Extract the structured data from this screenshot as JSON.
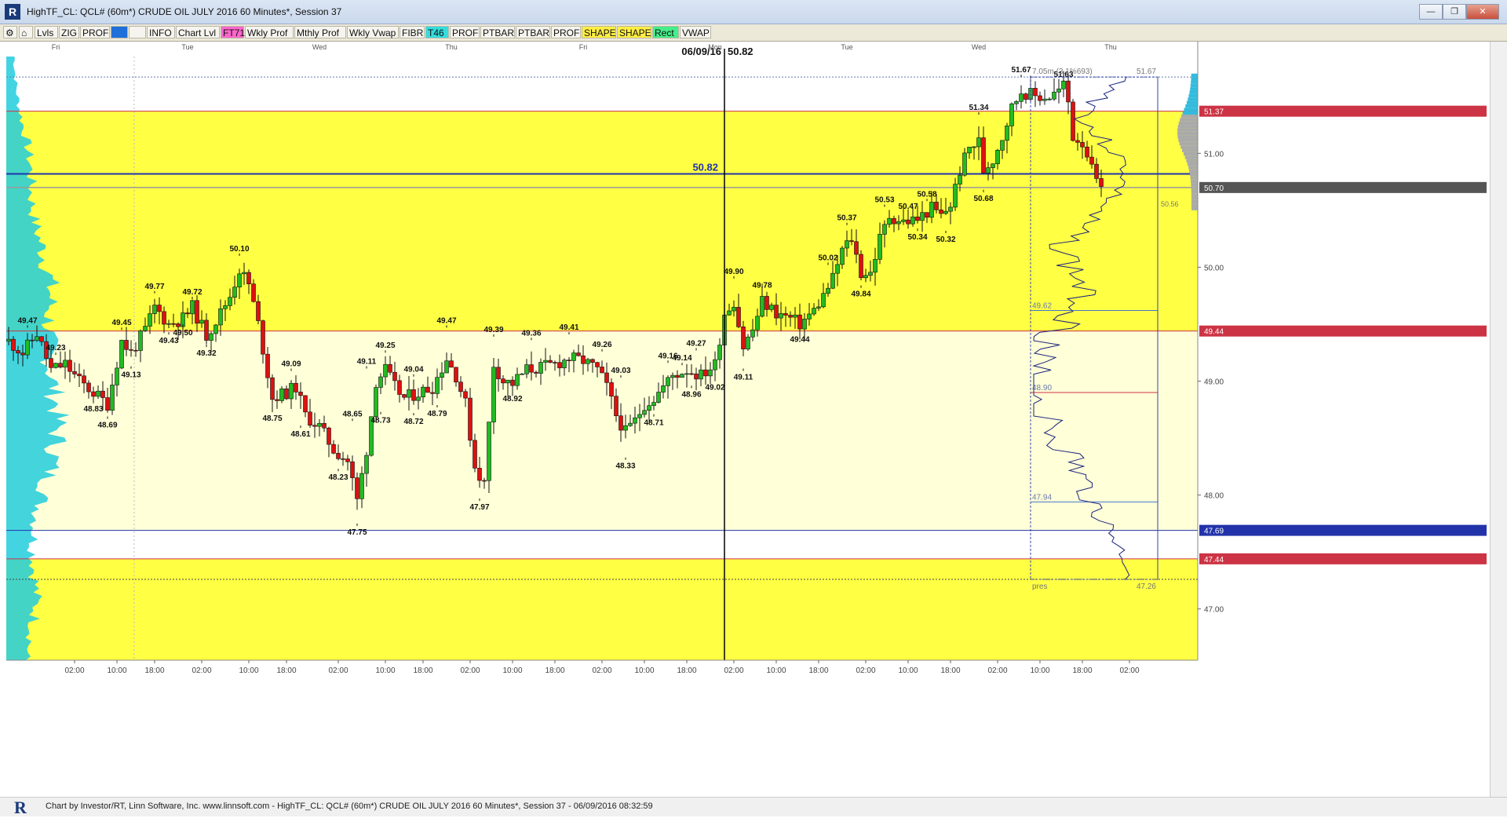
{
  "window": {
    "title": "HighTF_CL: QCL# (60m*) CRUDE OIL JULY 2016 60 Minutes*, Session 37",
    "minimize": "—",
    "maximize": "❐",
    "close": "✕"
  },
  "toolbar": {
    "items": [
      {
        "label": "Lvls",
        "color": "#f5f4ee"
      },
      {
        "label": "ZIG",
        "color": "#f5f4ee"
      },
      {
        "label": "PROF",
        "color": "#f5f4ee"
      },
      {
        "label": "",
        "color": "#1e6fd9"
      },
      {
        "label": "",
        "color": "#f5f4ee"
      },
      {
        "label": "INFO",
        "color": "#f5f4ee"
      },
      {
        "label": "Chart Lvl",
        "color": "#f5f4ee"
      },
      {
        "label": "FT71",
        "color": "#ff66cc"
      },
      {
        "label": "Wkly Prof",
        "color": "#f5f4ee"
      },
      {
        "label": "Mthly Prof",
        "color": "#f5f4ee"
      },
      {
        "label": "Wkly Vwap",
        "color": "#f5f4ee"
      },
      {
        "label": "FIBR",
        "color": "#f5f4ee"
      },
      {
        "label": "T46",
        "color": "#33dddd"
      },
      {
        "label": "PROF",
        "color": "#f5f4ee"
      },
      {
        "label": "PTBAR",
        "color": "#f5f4ee"
      },
      {
        "label": "PTBAR",
        "color": "#f5f4ee"
      },
      {
        "label": "PROF",
        "color": "#f5f4ee"
      },
      {
        "label": "SHAPE",
        "color": "#ffee44"
      },
      {
        "label": "SHAPE",
        "color": "#ffee44"
      },
      {
        "label": "Rect",
        "color": "#44ee88"
      },
      {
        "label": "VWAP",
        "color": "#f5f4ee"
      }
    ]
  },
  "status": {
    "text": "Chart by Investor/RT, Linn Software, Inc. www.linnsoft.com - HighTF_CL: QCL# (60m*) CRUDE OIL JULY 2016 60 Minutes*, Session 37 - 06/09/2016 08:32:59"
  },
  "colors": {
    "up": "#22bb22",
    "down": "#dd1111",
    "zone_yellow": "#ffff44",
    "zone_pale": "#ffffd8",
    "profile_cyan": "#22ccdd",
    "crosshair": "#000000",
    "line_blue": "#2233aa",
    "line_red": "#cc3344"
  },
  "chart_data": {
    "type": "candlestick",
    "instrument": "QCL# (60m*) CRUDE OIL JULY 2016 60 Minutes*",
    "ylim": [
      46.55,
      51.85
    ],
    "y_ticks": [
      47.0,
      48.0,
      49.0,
      50.0,
      51.0
    ],
    "y_tick_labels": [
      "47.00",
      "48.00",
      "49.00",
      "50.00",
      "51.00"
    ],
    "day_labels": [
      {
        "label": "Fri",
        "bar": 10
      },
      {
        "label": "Tue",
        "bar": 38
      },
      {
        "label": "Wed",
        "bar": 66
      },
      {
        "label": "Thu",
        "bar": 94
      },
      {
        "label": "Fri",
        "bar": 122
      },
      {
        "label": "Mon",
        "bar": 150
      },
      {
        "label": "Tue",
        "bar": 178
      },
      {
        "label": "Wed",
        "bar": 206
      },
      {
        "label": "Thu",
        "bar": 234
      }
    ],
    "time_labels": [
      {
        "label": "02:00",
        "bar": 14
      },
      {
        "label": "10:00",
        "bar": 23
      },
      {
        "label": "18:00",
        "bar": 31
      },
      {
        "label": "02:00",
        "bar": 41
      },
      {
        "label": "10:00",
        "bar": 51
      },
      {
        "label": "18:00",
        "bar": 59
      },
      {
        "label": "02:00",
        "bar": 70
      },
      {
        "label": "10:00",
        "bar": 80
      },
      {
        "label": "18:00",
        "bar": 88
      },
      {
        "label": "02:00",
        "bar": 98
      },
      {
        "label": "10:00",
        "bar": 107
      },
      {
        "label": "18:00",
        "bar": 116
      },
      {
        "label": "02:00",
        "bar": 126
      },
      {
        "label": "10:00",
        "bar": 135
      },
      {
        "label": "18:00",
        "bar": 144
      },
      {
        "label": "02:00",
        "bar": 154
      },
      {
        "label": "10:00",
        "bar": 163
      },
      {
        "label": "18:00",
        "bar": 172
      },
      {
        "label": "02:00",
        "bar": 182
      },
      {
        "label": "10:00",
        "bar": 191
      },
      {
        "label": "18:00",
        "bar": 200
      },
      {
        "label": "02:00",
        "bar": 210
      },
      {
        "label": "10:00",
        "bar": 219
      },
      {
        "label": "18:00",
        "bar": 228
      },
      {
        "label": "02:00",
        "bar": 238
      }
    ],
    "zones": [
      {
        "from": 50.82,
        "to": 51.37,
        "fill": "#ffff44"
      },
      {
        "from": 49.44,
        "to": 50.82,
        "fill": "#ffff44"
      },
      {
        "from": 47.69,
        "to": 49.44,
        "fill": "#ffffd8"
      },
      {
        "from": 46.55,
        "to": 47.44,
        "fill": "#ffff44"
      }
    ],
    "levels": [
      {
        "price": 51.37,
        "label": "51.37",
        "color": "#cc3344",
        "tag_bg": "#cc3344"
      },
      {
        "price": 50.82,
        "label": "50.82",
        "color": "#2233aa",
        "tag_bg": "none"
      },
      {
        "price": 50.7,
        "label": "50.70",
        "color": "#888888",
        "tag_bg": "#555555"
      },
      {
        "price": 49.44,
        "label": "49.44",
        "color": "#cc3344",
        "tag_bg": "#cc3344"
      },
      {
        "price": 47.69,
        "label": "47.69",
        "color": "#2233aa",
        "tag_bg": "#2233aa"
      },
      {
        "price": 47.44,
        "label": "47.44",
        "color": "#cc3344",
        "tag_bg": "#cc3344"
      }
    ],
    "crosshair": {
      "bar": 152,
      "price": 50.82,
      "date_label": "06/09/16",
      "price_label": "50.82"
    },
    "session_box": {
      "start_bar": 217,
      "end_bar": 244,
      "high": 51.67,
      "low": 47.26,
      "header": "7.05m (3.1%693)",
      "high_label": "51.67",
      "low_label": "47.26",
      "footer": "pres",
      "side_label": "50.56",
      "lines": [
        {
          "price": 49.62,
          "label": "49.62",
          "color": "#4477cc"
        },
        {
          "price": 48.9,
          "label": "48.90",
          "color": "#cc3344"
        },
        {
          "price": 47.94,
          "label": "47.94",
          "color": "#4477cc"
        }
      ]
    },
    "swing_labels": [
      {
        "bar": 4,
        "price": 49.47,
        "pos": "above",
        "label": "49.47"
      },
      {
        "bar": 10,
        "price": 49.23,
        "pos": "above",
        "label": "49.23"
      },
      {
        "bar": 18,
        "price": 48.83,
        "pos": "below",
        "label": "48.83"
      },
      {
        "bar": 21,
        "price": 48.69,
        "pos": "below",
        "label": "48.69"
      },
      {
        "bar": 24,
        "price": 49.45,
        "pos": "above",
        "label": "49.45"
      },
      {
        "bar": 26,
        "price": 49.13,
        "pos": "below",
        "label": "49.13"
      },
      {
        "bar": 31,
        "price": 49.77,
        "pos": "above",
        "label": "49.77"
      },
      {
        "bar": 34,
        "price": 49.43,
        "pos": "below",
        "label": "49.43"
      },
      {
        "bar": 37,
        "price": 49.5,
        "pos": "below",
        "label": "49.50"
      },
      {
        "bar": 39,
        "price": 49.72,
        "pos": "above",
        "label": "49.72"
      },
      {
        "bar": 42,
        "price": 49.32,
        "pos": "below",
        "label": "49.32"
      },
      {
        "bar": 49,
        "price": 50.1,
        "pos": "above",
        "label": "50.10"
      },
      {
        "bar": 56,
        "price": 48.75,
        "pos": "below",
        "label": "48.75"
      },
      {
        "bar": 60,
        "price": 49.09,
        "pos": "above",
        "label": "49.09"
      },
      {
        "bar": 62,
        "price": 48.61,
        "pos": "below",
        "label": "48.61"
      },
      {
        "bar": 70,
        "price": 48.23,
        "pos": "below",
        "label": "48.23"
      },
      {
        "bar": 73,
        "price": 48.65,
        "pos": "above",
        "label": "48.65"
      },
      {
        "bar": 74,
        "price": 47.75,
        "pos": "below",
        "label": "47.75"
      },
      {
        "bar": 76,
        "price": 49.11,
        "pos": "above",
        "label": "49.11"
      },
      {
        "bar": 79,
        "price": 48.73,
        "pos": "below",
        "label": "48.73"
      },
      {
        "bar": 80,
        "price": 49.25,
        "pos": "above",
        "label": "49.25"
      },
      {
        "bar": 86,
        "price": 49.04,
        "pos": "above",
        "label": "49.04"
      },
      {
        "bar": 86,
        "price": 48.72,
        "pos": "below",
        "label": "48.72"
      },
      {
        "bar": 91,
        "price": 48.79,
        "pos": "below",
        "label": "48.79"
      },
      {
        "bar": 93,
        "price": 49.47,
        "pos": "above",
        "label": "49.47"
      },
      {
        "bar": 100,
        "price": 47.97,
        "pos": "below",
        "label": "47.97"
      },
      {
        "bar": 103,
        "price": 49.39,
        "pos": "above",
        "label": "49.39"
      },
      {
        "bar": 107,
        "price": 48.92,
        "pos": "below",
        "label": "48.92"
      },
      {
        "bar": 111,
        "price": 49.36,
        "pos": "above",
        "label": "49.36"
      },
      {
        "bar": 119,
        "price": 49.41,
        "pos": "above",
        "label": "49.41"
      },
      {
        "bar": 126,
        "price": 49.26,
        "pos": "above",
        "label": "49.26"
      },
      {
        "bar": 130,
        "price": 49.03,
        "pos": "above",
        "label": "49.03"
      },
      {
        "bar": 131,
        "price": 48.33,
        "pos": "below",
        "label": "48.33"
      },
      {
        "bar": 137,
        "price": 48.71,
        "pos": "below",
        "label": "48.71"
      },
      {
        "bar": 140,
        "price": 49.16,
        "pos": "above",
        "label": "49.16"
      },
      {
        "bar": 143,
        "price": 49.14,
        "pos": "above",
        "label": "49.14"
      },
      {
        "bar": 145,
        "price": 48.96,
        "pos": "below",
        "label": "48.96"
      },
      {
        "bar": 146,
        "price": 49.27,
        "pos": "above",
        "label": "49.27"
      },
      {
        "bar": 150,
        "price": 49.02,
        "pos": "below",
        "label": "49.02"
      },
      {
        "bar": 154,
        "price": 49.9,
        "pos": "above",
        "label": "49.90"
      },
      {
        "bar": 156,
        "price": 49.11,
        "pos": "below",
        "label": "49.11"
      },
      {
        "bar": 160,
        "price": 49.78,
        "pos": "above",
        "label": "49.78"
      },
      {
        "bar": 168,
        "price": 49.44,
        "pos": "below",
        "label": "49.44"
      },
      {
        "bar": 174,
        "price": 50.02,
        "pos": "above",
        "label": "50.02"
      },
      {
        "bar": 178,
        "price": 50.37,
        "pos": "above",
        "label": "50.37"
      },
      {
        "bar": 181,
        "price": 49.84,
        "pos": "below",
        "label": "49.84"
      },
      {
        "bar": 186,
        "price": 50.53,
        "pos": "above",
        "label": "50.53"
      },
      {
        "bar": 191,
        "price": 50.47,
        "pos": "above",
        "label": "50.47"
      },
      {
        "bar": 193,
        "price": 50.34,
        "pos": "below",
        "label": "50.34"
      },
      {
        "bar": 195,
        "price": 50.58,
        "pos": "above",
        "label": "50.58"
      },
      {
        "bar": 199,
        "price": 50.32,
        "pos": "below",
        "label": "50.32"
      },
      {
        "bar": 206,
        "price": 51.34,
        "pos": "above",
        "label": "51.34"
      },
      {
        "bar": 207,
        "price": 50.68,
        "pos": "below",
        "label": "50.68"
      },
      {
        "bar": 215,
        "price": 51.67,
        "pos": "above",
        "label": "51.67"
      },
      {
        "bar": 224,
        "price": 51.63,
        "pos": "above",
        "label": "51.63"
      }
    ],
    "anchors": [
      [
        0,
        49.35
      ],
      [
        3,
        49.25
      ],
      [
        6,
        49.42
      ],
      [
        9,
        49.1
      ],
      [
        12,
        49.15
      ],
      [
        15,
        49.0
      ],
      [
        18,
        48.9
      ],
      [
        21,
        48.8
      ],
      [
        24,
        49.35
      ],
      [
        26,
        49.25
      ],
      [
        29,
        49.45
      ],
      [
        31,
        49.65
      ],
      [
        34,
        49.5
      ],
      [
        37,
        49.55
      ],
      [
        39,
        49.65
      ],
      [
        42,
        49.4
      ],
      [
        45,
        49.6
      ],
      [
        47,
        49.75
      ],
      [
        49,
        49.98
      ],
      [
        51,
        49.85
      ],
      [
        53,
        49.5
      ],
      [
        56,
        48.85
      ],
      [
        59,
        48.9
      ],
      [
        61,
        48.95
      ],
      [
        63,
        48.7
      ],
      [
        66,
        48.6
      ],
      [
        69,
        48.4
      ],
      [
        72,
        48.3
      ],
      [
        74,
        47.95
      ],
      [
        76,
        48.4
      ],
      [
        78,
        49.0
      ],
      [
        80,
        49.1
      ],
      [
        82,
        48.95
      ],
      [
        84,
        48.85
      ],
      [
        87,
        48.9
      ],
      [
        90,
        48.95
      ],
      [
        93,
        49.2
      ],
      [
        95,
        49.05
      ],
      [
        97,
        48.8
      ],
      [
        99,
        48.25
      ],
      [
        101,
        48.1
      ],
      [
        103,
        49.15
      ],
      [
        105,
        49.0
      ],
      [
        107,
        48.98
      ],
      [
        110,
        49.1
      ],
      [
        113,
        49.12
      ],
      [
        116,
        49.15
      ],
      [
        119,
        49.2
      ],
      [
        122,
        49.18
      ],
      [
        125,
        49.1
      ],
      [
        127,
        48.95
      ],
      [
        129,
        48.7
      ],
      [
        131,
        48.55
      ],
      [
        133,
        48.65
      ],
      [
        135,
        48.8
      ],
      [
        137,
        48.85
      ],
      [
        139,
        48.95
      ],
      [
        141,
        49.05
      ],
      [
        144,
        49.1
      ],
      [
        147,
        49.05
      ],
      [
        150,
        49.15
      ],
      [
        152,
        49.6
      ],
      [
        154,
        49.7
      ],
      [
        156,
        49.3
      ],
      [
        158,
        49.45
      ],
      [
        160,
        49.7
      ],
      [
        163,
        49.6
      ],
      [
        166,
        49.55
      ],
      [
        168,
        49.5
      ],
      [
        171,
        49.62
      ],
      [
        173,
        49.75
      ],
      [
        175,
        49.9
      ],
      [
        177,
        50.15
      ],
      [
        179,
        50.25
      ],
      [
        181,
        49.95
      ],
      [
        183,
        49.95
      ],
      [
        185,
        50.25
      ],
      [
        187,
        50.45
      ],
      [
        190,
        50.4
      ],
      [
        193,
        50.42
      ],
      [
        196,
        50.52
      ],
      [
        198,
        50.45
      ],
      [
        200,
        50.55
      ],
      [
        202,
        50.85
      ],
      [
        204,
        51.05
      ],
      [
        206,
        51.1
      ],
      [
        207,
        50.85
      ],
      [
        209,
        50.95
      ],
      [
        211,
        51.15
      ],
      [
        213,
        51.4
      ],
      [
        215,
        51.55
      ],
      [
        218,
        51.5
      ],
      [
        221,
        51.5
      ],
      [
        223,
        51.55
      ],
      [
        224,
        51.6
      ],
      [
        225,
        51.45
      ],
      [
        226,
        51.15
      ],
      [
        228,
        51.1
      ],
      [
        229,
        51.0
      ],
      [
        230,
        50.85
      ],
      [
        231,
        50.75
      ],
      [
        232,
        50.65
      ]
    ]
  }
}
